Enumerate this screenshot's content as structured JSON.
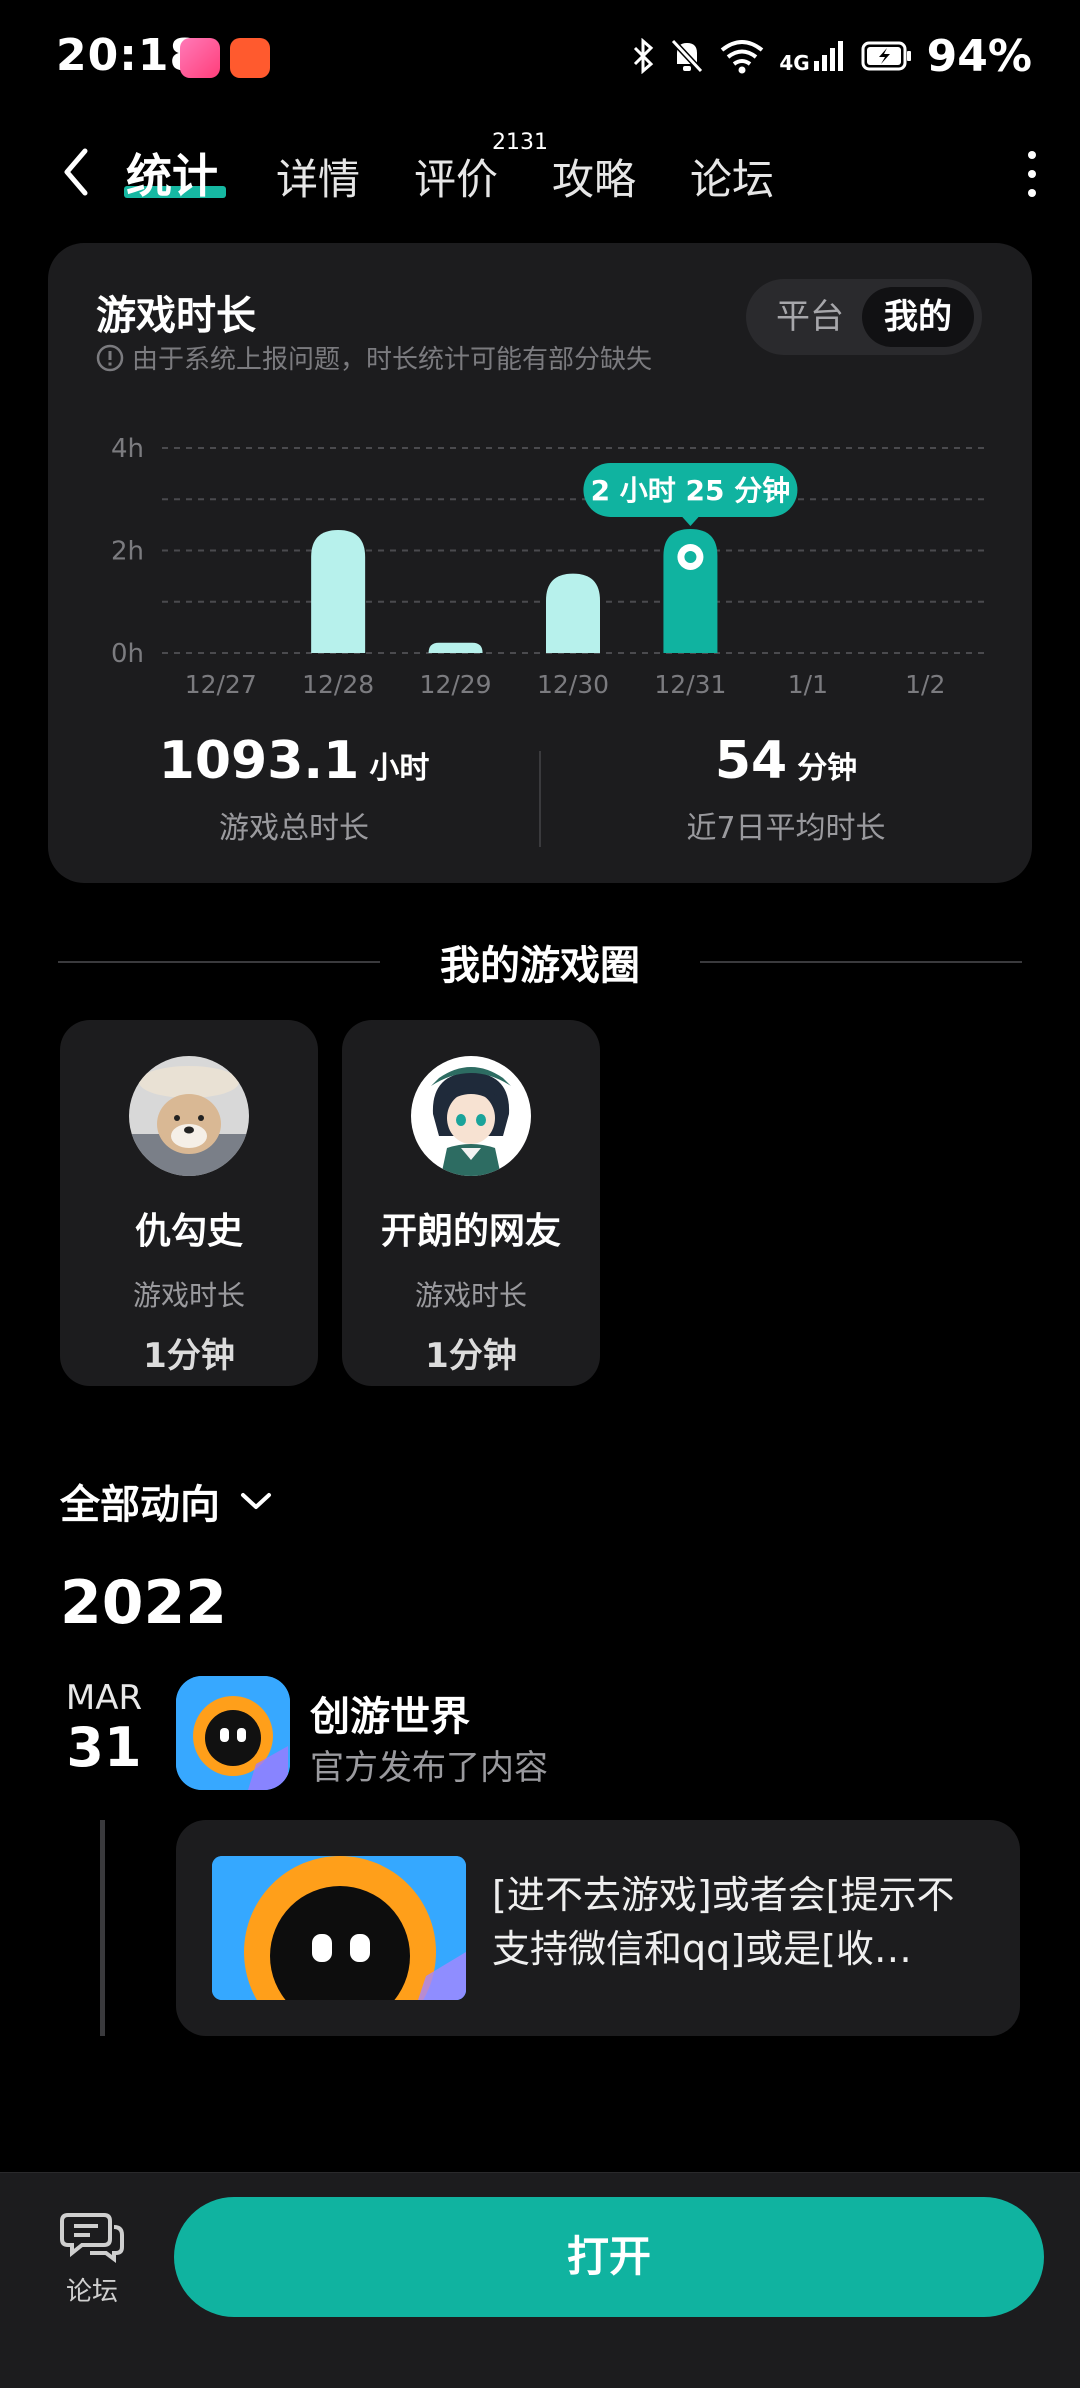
{
  "status_bar": {
    "time": "20:18",
    "network": "4G",
    "battery": "94%"
  },
  "nav": {
    "tabs": [
      {
        "label": "统计"
      },
      {
        "label": "详情"
      },
      {
        "label": "评价"
      },
      {
        "label": "攻略"
      },
      {
        "label": "论坛"
      }
    ],
    "reviews_count": "2131",
    "active_tab": "统计",
    "accent_color": "#16b8a2"
  },
  "stats_card": {
    "title": "游戏时长",
    "note": "由于系统上报问题，时长统计可能有部分缺失",
    "toggle": {
      "option_platform": "平台",
      "option_mine": "我的",
      "selected": "我的"
    },
    "total": {
      "value": "1093.1",
      "unit": "小时",
      "label": "游戏总时长"
    },
    "avg": {
      "value": "54",
      "unit": "分钟",
      "label": "近7日平均时长"
    }
  },
  "chart_data": {
    "type": "bar",
    "categories": [
      "12/27",
      "12/28",
      "12/29",
      "12/30",
      "12/31",
      "1/1",
      "1/2"
    ],
    "values": [
      0,
      2.4,
      0.2,
      1.55,
      2.42,
      0,
      0
    ],
    "y_ticks": [
      "0h",
      "2h",
      "4h"
    ],
    "ylim": [
      0,
      4
    ],
    "grid": true,
    "highlight_index": 4,
    "tooltip": "2 小时 25 分钟",
    "bar_color": "#b7f1ec",
    "highlight_color": "#10b3a0"
  },
  "game_circle": {
    "title": "我的游戏圈",
    "friends": [
      {
        "name": "仇勾史",
        "label": "游戏时长",
        "value": "1分钟"
      },
      {
        "name": "开朗的网友",
        "label": "游戏时长",
        "value": "1分钟"
      }
    ]
  },
  "feed": {
    "filter_label": "全部动向",
    "year": "2022",
    "month": "MAR",
    "day": "31",
    "app_name": "创游世界",
    "app_sub": "官方发布了内容",
    "post_text": "[进不去游戏]或者会[提示不支持微信和qq]或是[收…"
  },
  "bottom": {
    "forum_label": "论坛",
    "open_label": "打开"
  }
}
